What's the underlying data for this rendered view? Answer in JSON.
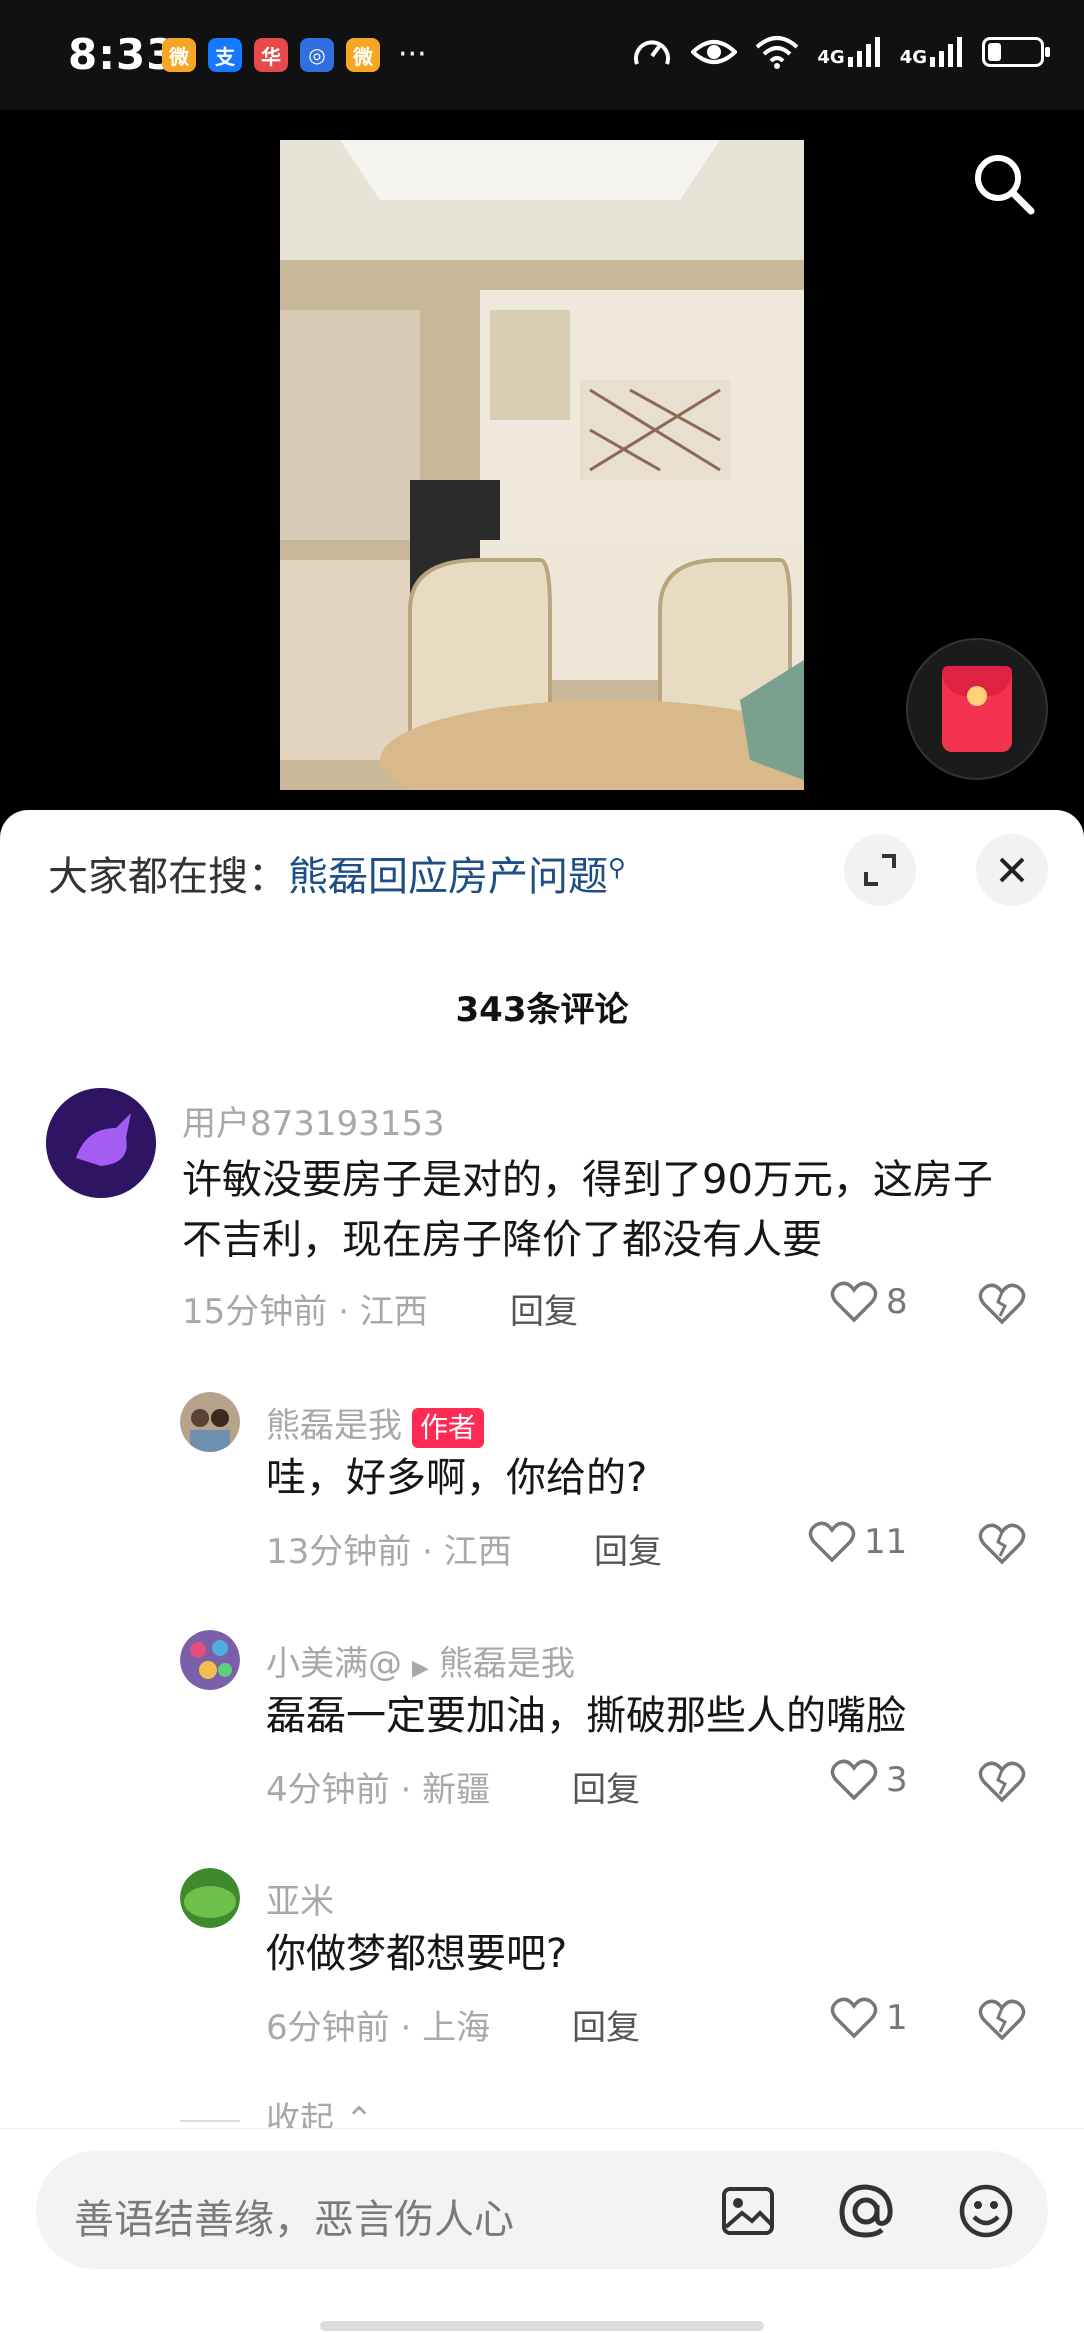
{
  "status_bar": {
    "time": "8:33",
    "apps": [
      {
        "icon": "weibo-icon",
        "glyph": "微",
        "color": "#f5a623"
      },
      {
        "icon": "alipay-icon",
        "glyph": "支",
        "color": "#1677ff"
      },
      {
        "icon": "huawei-app-icon",
        "glyph": "华",
        "color": "#e64a4a"
      },
      {
        "icon": "blue-app-icon",
        "glyph": "◎",
        "color": "#2f6fe0"
      },
      {
        "icon": "weibo-icon",
        "glyph": "微",
        "color": "#f5a623"
      }
    ],
    "more": "···",
    "network_1": "4G",
    "network_2": "4G",
    "battery_level": 0.25
  },
  "video": {
    "background": "#000000"
  },
  "comments_panel": {
    "hot_search_label": "大家都在搜：",
    "hot_search_query": "熊磊回应房产问题",
    "comment_count": "343条评论",
    "accent_color": "#fe2c55",
    "link_color": "#1d4e86",
    "comments": [
      {
        "user": "用户873193153",
        "text": "许敏没要房子是对的，得到了90万元，这房子不吉利，现在房子降价了都没有人要",
        "time": "15分钟前",
        "location": "江西",
        "reply_label": "回复",
        "likes": "8"
      }
    ],
    "replies": [
      {
        "user": "熊磊是我",
        "badge": "作者",
        "text": "哇，好多啊，你给的?",
        "time": "13分钟前",
        "location": "江西",
        "reply_label": "回复",
        "likes": "11"
      },
      {
        "user": "小美满@",
        "reply_to": "熊磊是我",
        "text": "磊磊一定要加油，撕破那些人的嘴脸",
        "time": "4分钟前",
        "location": "新疆",
        "reply_label": "回复",
        "likes": "3"
      },
      {
        "user": "亚米",
        "text": "你做梦都想要吧?",
        "time": "6分钟前",
        "location": "上海",
        "reply_label": "回复",
        "likes": "1"
      }
    ],
    "collapse_label": "收起"
  },
  "input_bar": {
    "placeholder": "善语结善缘，恶言伤人心",
    "icons": [
      "image-icon",
      "at-icon",
      "emoji-icon"
    ]
  }
}
